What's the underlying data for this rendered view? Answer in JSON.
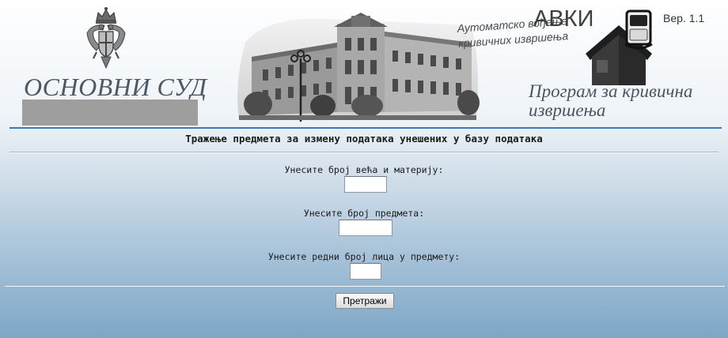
{
  "header": {
    "court_name": "ОСНОВНИ СУД",
    "app_acronym": "АВКИ",
    "app_version": "Вер. 1.1",
    "app_tagline_line1": "Аутоматско вођење",
    "app_tagline_line2": "кривичних извршења",
    "app_title_line1": "Програм за кривична",
    "app_title_line2": "извршења"
  },
  "form": {
    "heading": "Тражење предмета за измену података унешених у базу података",
    "fields": [
      {
        "label": "Унесите број већа и материју:",
        "value": ""
      },
      {
        "label": "Унесите број предмета:",
        "value": ""
      },
      {
        "label": "Унесите редни број лица у предмету:",
        "value": ""
      }
    ],
    "submit_label": "Претражи"
  },
  "colors": {
    "accent_rule": "#3b79b5",
    "background_top": "#ffffff",
    "background_bottom": "#7ea6c6"
  },
  "icons": [
    "coat-of-arms-icon",
    "court-building-image",
    "house-logo-icon"
  ]
}
